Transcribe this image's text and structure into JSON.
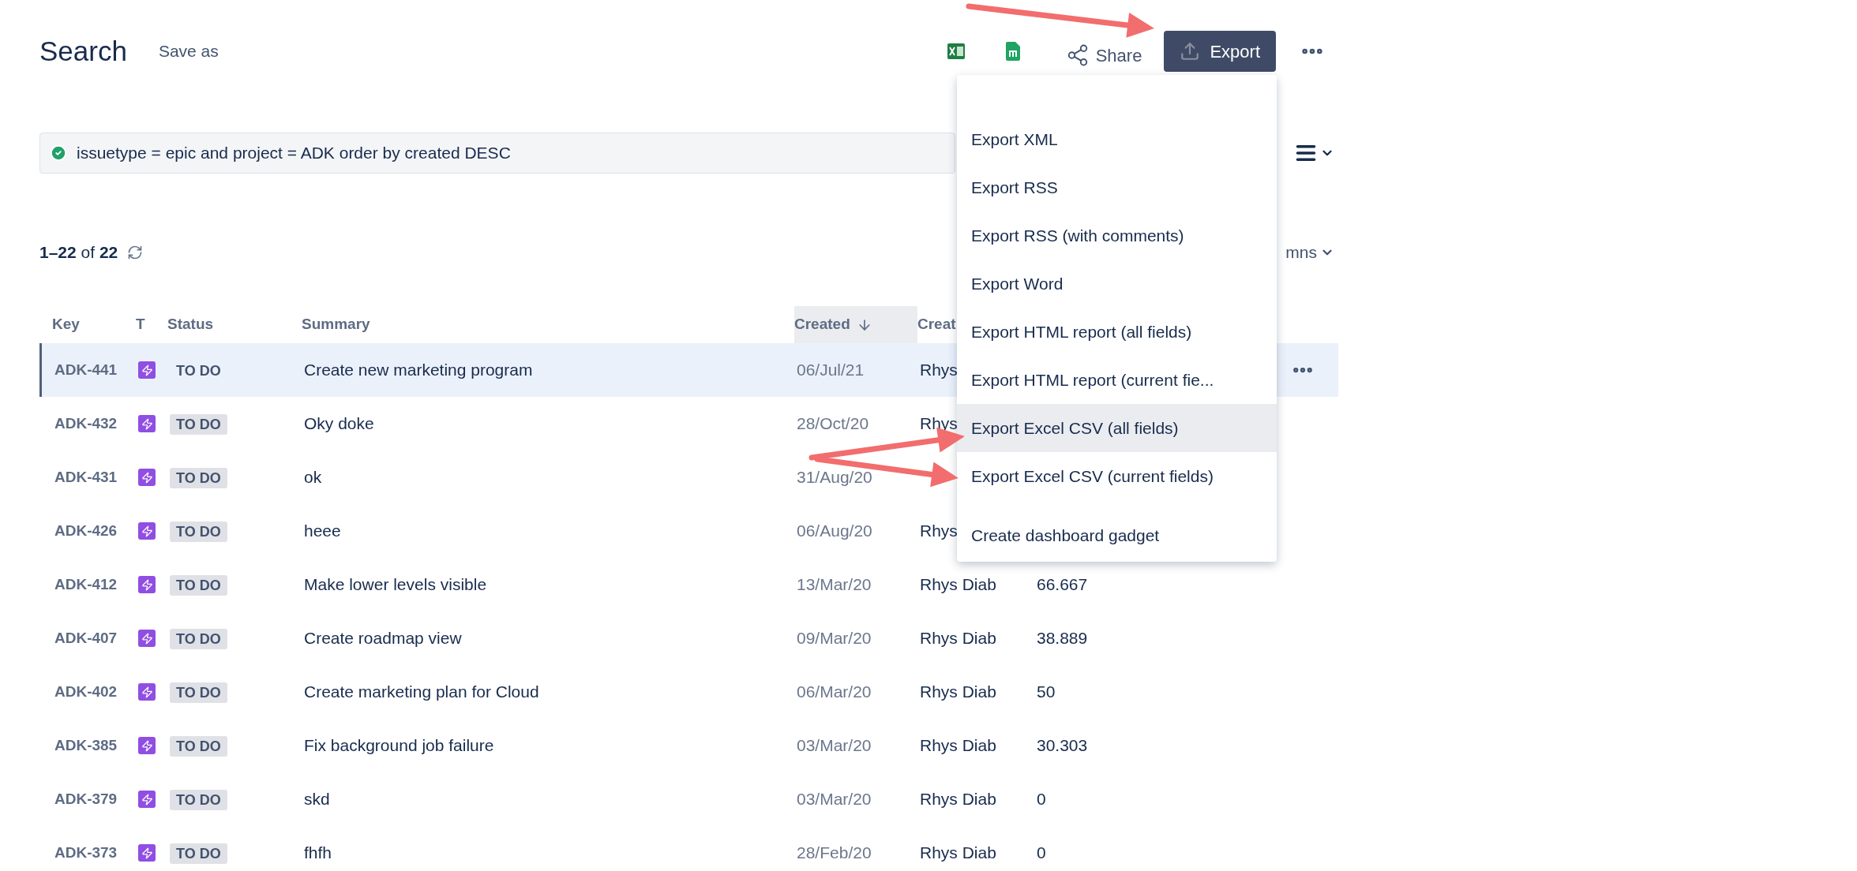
{
  "header": {
    "title": "Search",
    "save_as": "Save as",
    "share": "Share",
    "export": "Export"
  },
  "query": {
    "text": "issuetype = epic and project = ADK order by created DESC",
    "valid": true
  },
  "count": "**1–22** of **22**",
  "columns_button": "mns",
  "table": {
    "columns": [
      {
        "label": "Key",
        "sorted": false
      },
      {
        "label": "T",
        "sorted": false
      },
      {
        "label": "Status",
        "sorted": false
      },
      {
        "label": "Summary",
        "sorted": false
      },
      {
        "label": "Created",
        "sorted": true
      },
      {
        "label": "Creat",
        "sorted": false
      }
    ],
    "rows": [
      {
        "key": "ADK-441",
        "status": "TO DO",
        "summary": "Create new marketing program",
        "created": "06/Jul/21",
        "creator": "Rhys",
        "selected": true
      },
      {
        "key": "ADK-432",
        "status": "TO DO",
        "summary": "Oky doke",
        "created": "28/Oct/20",
        "creator": "Rhys",
        "selected": false
      },
      {
        "key": "ADK-431",
        "status": "TO DO",
        "summary": "ok",
        "created": "31/Aug/20",
        "selected": false
      },
      {
        "key": "ADK-426",
        "status": "TO DO",
        "summary": "heee",
        "created": "06/Aug/20",
        "creator": "Rhys",
        "selected": false
      },
      {
        "key": "ADK-412",
        "status": "TO DO",
        "summary": "Make lower levels visible",
        "created": "13/Mar/20",
        "creator": "Rhys Diab",
        "value": "66.667",
        "selected": false
      },
      {
        "key": "ADK-407",
        "status": "TO DO",
        "summary": "Create roadmap view",
        "created": "09/Mar/20",
        "creator": "Rhys Diab",
        "value": "38.889",
        "selected": false
      },
      {
        "key": "ADK-402",
        "status": "TO DO",
        "summary": "Create marketing plan for Cloud",
        "created": "06/Mar/20",
        "creator": "Rhys Diab",
        "value": "50",
        "selected": false
      },
      {
        "key": "ADK-385",
        "status": "TO DO",
        "summary": "Fix background job failure",
        "created": "03/Mar/20",
        "creator": "Rhys Diab",
        "value": "30.303",
        "selected": false
      },
      {
        "key": "ADK-379",
        "status": "TO DO",
        "summary": "skd",
        "created": "03/Mar/20",
        "creator": "Rhys Diab",
        "value": "0",
        "selected": false
      },
      {
        "key": "ADK-373",
        "status": "TO DO",
        "summary": "fhfh",
        "created": "28/Feb/20",
        "creator": "Rhys Diab",
        "value": "0",
        "selected": false
      }
    ]
  },
  "export_menu": {
    "sections": [
      [
        {
          "label": "Export XML",
          "highlighted": false
        },
        {
          "label": "Export RSS",
          "highlighted": false
        },
        {
          "label": "Export RSS (with comments)",
          "highlighted": false
        },
        {
          "label": "Export Word",
          "highlighted": false
        },
        {
          "label": "Export HTML report (all fields)",
          "highlighted": false
        },
        {
          "label": "Export HTML report (current fie...",
          "highlighted": false
        },
        {
          "label": "Export Excel CSV (all fields)",
          "highlighted": true
        },
        {
          "label": "Export Excel CSV (current fields)",
          "highlighted": false
        }
      ],
      [
        {
          "label": "Create dashboard gadget",
          "highlighted": false
        }
      ]
    ]
  }
}
